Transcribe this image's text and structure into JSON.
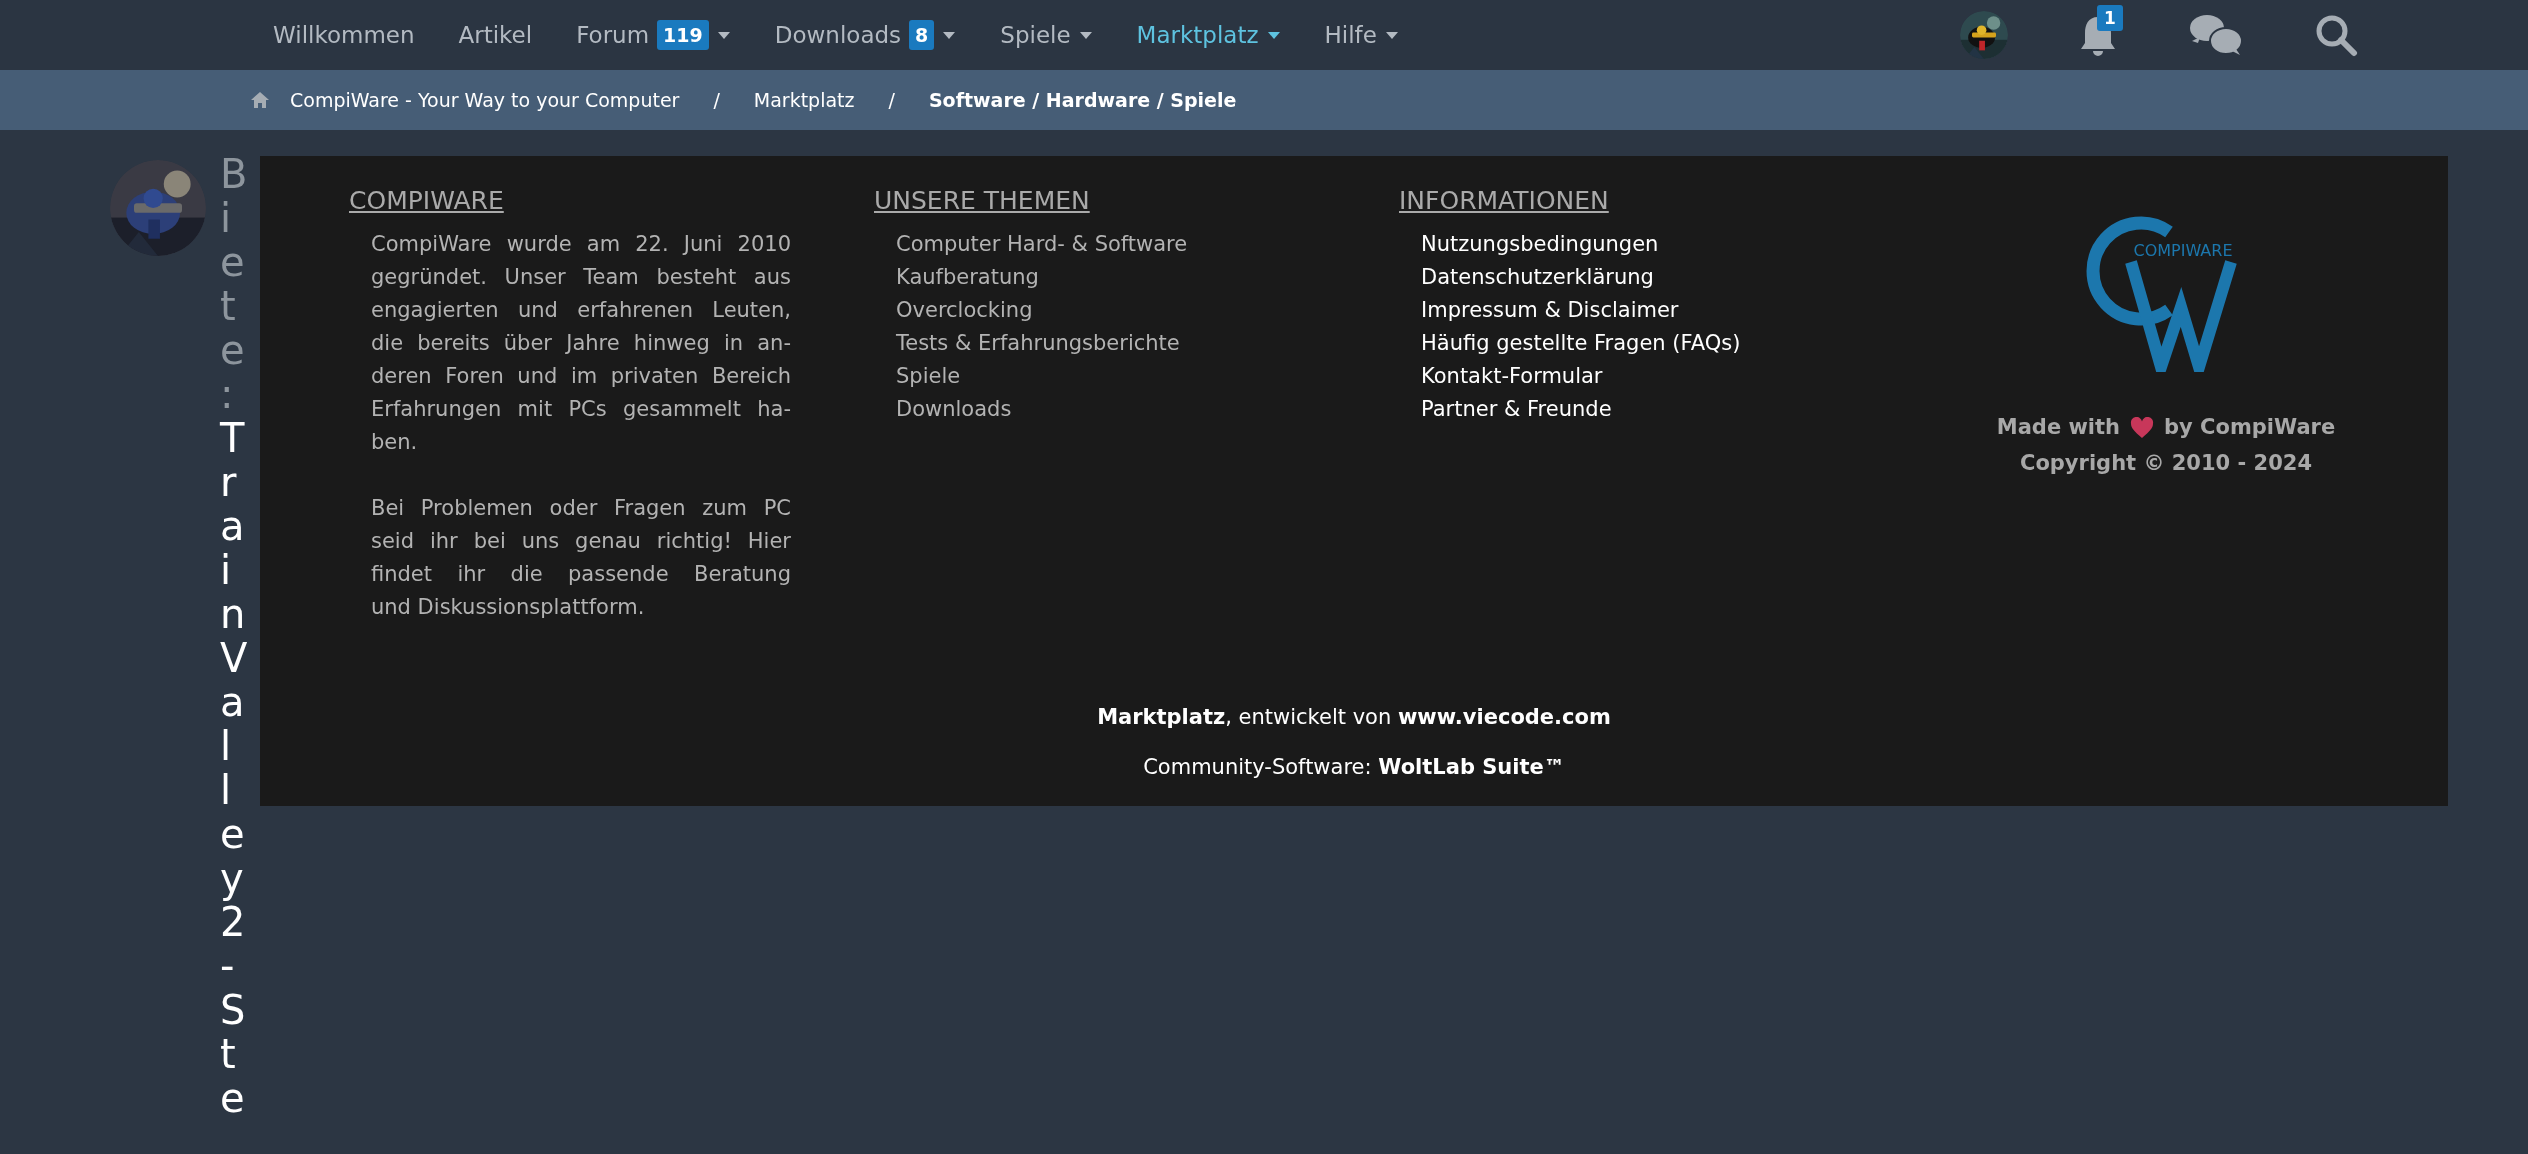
{
  "nav": {
    "items": [
      {
        "label": "Willkommen",
        "dropdown": false,
        "selected": false
      },
      {
        "label": "Artikel",
        "dropdown": false,
        "selected": false
      },
      {
        "label": "Forum",
        "badge": "119",
        "dropdown": true,
        "selected": false
      },
      {
        "label": "Downloads",
        "badge": "8",
        "dropdown": true,
        "selected": false
      },
      {
        "label": "Spiele",
        "dropdown": true,
        "selected": false
      },
      {
        "label": "Marktplatz",
        "dropdown": true,
        "selected": true
      },
      {
        "label": "Hilfe",
        "dropdown": true,
        "selected": false
      }
    ],
    "notifications_badge": "1"
  },
  "breadcrumb": [
    {
      "label": "CompiWare - Your Way to your Computer",
      "current": false
    },
    {
      "separator": "/",
      "label": "Marktplatz",
      "current": false
    },
    {
      "separator": "/",
      "label": "Software / Hardware / Spiele",
      "current": true
    }
  ],
  "post": {
    "prefix": "Biete:",
    "title": "TrainValley2 - Ste"
  },
  "footer": {
    "columns": [
      {
        "kind": "text",
        "heading": "COMPIWARE",
        "paragraphs": [
          [
            "CompiWare wurde am 22. Juni 2010",
            "gegründet. Unser Team besteht aus",
            "engagierten und erfahrenen Leuten,",
            "die bereits über Jahre hinweg in an-",
            "deren Foren und im privaten Bereich",
            "Erfahrungen mit PCs gesammelt ha-",
            "ben."
          ],
          [
            "Bei Problemen oder Fragen zum PC",
            "seid ihr bei uns genau richtig! Hier",
            "findet ihr die passende Beratung",
            "und Diskussionsplattform."
          ]
        ]
      },
      {
        "kind": "topics",
        "heading": "UNSERE THEMEN",
        "links": [
          "Computer Hard- & Software",
          "Kaufberatung",
          "Overclocking",
          "Tests & Erfahrungsberichte",
          "Spiele",
          "Downloads"
        ]
      },
      {
        "kind": "info",
        "heading": "INFORMATIONEN",
        "links": [
          "Nutzungsbedingungen",
          "Datenschutzerklärung",
          "Impressum & Disclaimer",
          "Häufig gestellte Fragen (FAQs)",
          "Kontakt-Formular",
          "Partner & Freunde"
        ]
      },
      {
        "kind": "brand",
        "logo_text": "COMPIWARE",
        "made_with": "Made with",
        "made_by": "by CompiWare",
        "copyright": "Copyright © 2010 - 2024"
      }
    ],
    "credits": [
      "**Marktplatz**, entwickelt von **www.viecode.com**",
      "Community-Software: **WoltLab Suite™**"
    ]
  }
}
